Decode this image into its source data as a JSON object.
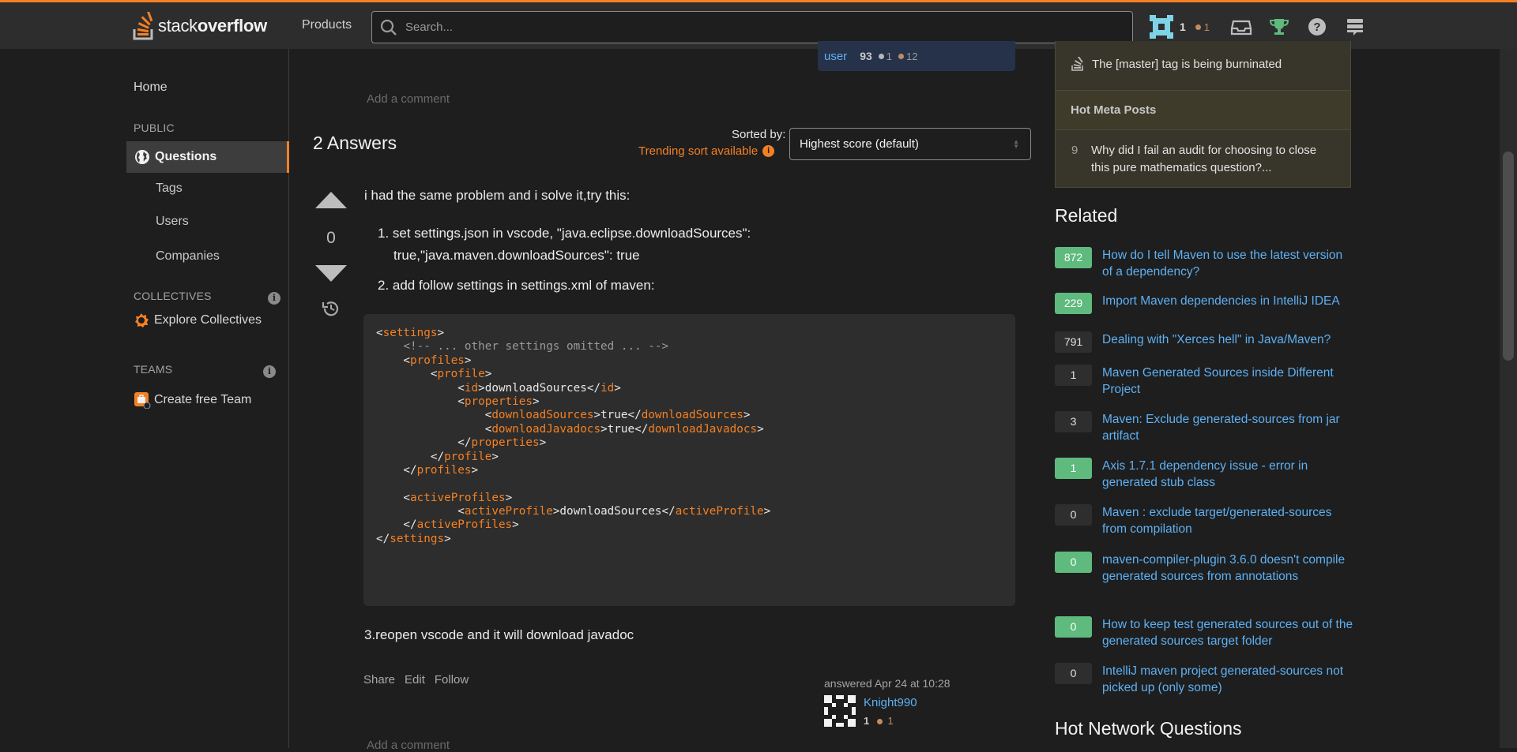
{
  "header": {
    "logo_prefix": "stack",
    "logo_suffix": "overflow",
    "products_label": "Products",
    "search_placeholder": "Search...",
    "reputation": "1",
    "bronze_badges": "1"
  },
  "leftnav": {
    "home": "Home",
    "public_label": "PUBLIC",
    "questions": "Questions",
    "tags": "Tags",
    "users": "Users",
    "companies": "Companies",
    "collectives_label": "COLLECTIVES",
    "explore_collectives": "Explore Collectives",
    "teams_label": "TEAMS",
    "create_team": "Create free Team"
  },
  "question_user": {
    "name": "user",
    "reputation": "93",
    "silver": "1",
    "bronze": "12"
  },
  "add_comment": "Add a comment",
  "answers": {
    "heading": "2 Answers",
    "sorted_by_label": "Sorted by:",
    "trending": "Trending sort available",
    "sort_value": "Highest score (default)"
  },
  "answer": {
    "votes": "0",
    "intro": "i had the same problem and i solve it,try this:",
    "step1_line1": "1.  set settings.json in vscode, \"java.eclipse.downloadSources\":",
    "step1_line2": "true,\"java.maven.downloadSources\": true",
    "step2": "2.  add follow settings in settings.xml of maven:",
    "step3": "3.reopen vscode and it will download javadoc",
    "menu": {
      "share": "Share",
      "edit": "Edit",
      "follow": "Follow"
    },
    "answered": "answered Apr 24 at 10:28",
    "author": "Knight990",
    "author_rep": "1",
    "author_bronze": "1"
  },
  "code_lines": [
    [
      [
        "p",
        "<"
      ],
      [
        "t",
        "settings"
      ],
      [
        "p",
        ">"
      ]
    ],
    [
      [
        "p",
        "    "
      ],
      [
        "c",
        "<!-- ... other settings omitted ... -->"
      ]
    ],
    [
      [
        "p",
        "    <"
      ],
      [
        "t",
        "profiles"
      ],
      [
        "p",
        ">"
      ]
    ],
    [
      [
        "p",
        "        <"
      ],
      [
        "t",
        "profile"
      ],
      [
        "p",
        ">"
      ]
    ],
    [
      [
        "p",
        "            <"
      ],
      [
        "t",
        "id"
      ],
      [
        "p",
        ">downloadSources</"
      ],
      [
        "t",
        "id"
      ],
      [
        "p",
        ">"
      ]
    ],
    [
      [
        "p",
        "            <"
      ],
      [
        "t",
        "properties"
      ],
      [
        "p",
        ">"
      ]
    ],
    [
      [
        "p",
        "                <"
      ],
      [
        "t",
        "downloadSources"
      ],
      [
        "p",
        ">true</"
      ],
      [
        "t",
        "downloadSources"
      ],
      [
        "p",
        ">"
      ]
    ],
    [
      [
        "p",
        "                <"
      ],
      [
        "t",
        "downloadJavadocs"
      ],
      [
        "p",
        ">true</"
      ],
      [
        "t",
        "downloadJavadocs"
      ],
      [
        "p",
        ">"
      ]
    ],
    [
      [
        "p",
        "            </"
      ],
      [
        "t",
        "properties"
      ],
      [
        "p",
        ">"
      ]
    ],
    [
      [
        "p",
        "        </"
      ],
      [
        "t",
        "profile"
      ],
      [
        "p",
        ">"
      ]
    ],
    [
      [
        "p",
        "    </"
      ],
      [
        "t",
        "profiles"
      ],
      [
        "p",
        ">"
      ]
    ],
    [
      [
        "p",
        ""
      ]
    ],
    [
      [
        "p",
        "    <"
      ],
      [
        "t",
        "activeProfiles"
      ],
      [
        "p",
        ">"
      ]
    ],
    [
      [
        "p",
        "            <"
      ],
      [
        "t",
        "activeProfile"
      ],
      [
        "p",
        ">downloadSources</"
      ],
      [
        "t",
        "activeProfile"
      ],
      [
        "p",
        ">"
      ]
    ],
    [
      [
        "p",
        "    </"
      ],
      [
        "t",
        "activeProfiles"
      ],
      [
        "p",
        ">"
      ]
    ],
    [
      [
        "p",
        "</"
      ],
      [
        "t",
        "settings"
      ],
      [
        "p",
        ">"
      ]
    ]
  ],
  "meta": {
    "burninated": "The [master] tag is being burninated",
    "hot_meta_heading": "Hot Meta Posts",
    "hot_post_score": "9",
    "hot_post_title": "Why did I fail an audit for choosing to close this pure mathematics question?..."
  },
  "related": {
    "heading": "Related",
    "items": [
      {
        "score": "872",
        "accepted": true,
        "title": "How do I tell Maven to use the latest version of a dependency?"
      },
      {
        "score": "229",
        "accepted": true,
        "title": "Import Maven dependencies in IntelliJ IDEA"
      },
      {
        "score": "791",
        "accepted": false,
        "title": "Dealing with \"Xerces hell\" in Java/Maven?"
      },
      {
        "score": "1",
        "accepted": false,
        "title": "Maven Generated Sources inside Different Project"
      },
      {
        "score": "3",
        "accepted": false,
        "title": "Maven: Exclude generated-sources from jar artifact"
      },
      {
        "score": "1",
        "accepted": true,
        "title": "Axis 1.7.1 dependency issue - error in generated stub class"
      },
      {
        "score": "0",
        "accepted": false,
        "title": "Maven : exclude target/generated-sources from compilation"
      },
      {
        "score": "0",
        "accepted": true,
        "title": "maven-compiler-plugin 3.6.0 doesn't compile generated sources from annotations"
      },
      {
        "score": "0",
        "accepted": true,
        "title": "How to keep test generated sources out of the generated sources target folder"
      },
      {
        "score": "0",
        "accepted": false,
        "title": "IntelliJ maven project generated-sources not picked up (only some)"
      }
    ]
  },
  "hot_network": "Hot Network Questions",
  "colors": {
    "accent": "#f48024",
    "link": "#5eb0f3",
    "accepted": "#5fba7d"
  }
}
